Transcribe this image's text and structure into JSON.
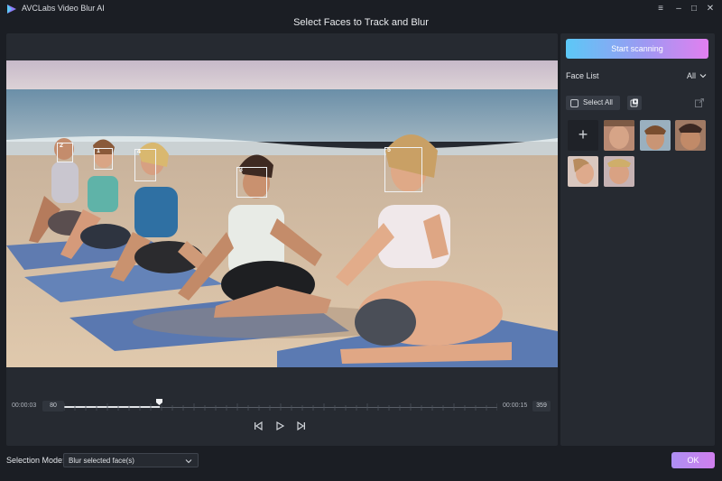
{
  "window": {
    "title": "AVCLabs Video Blur AI",
    "controls": [
      "≡",
      "–",
      "□",
      "✕"
    ]
  },
  "page_heading": "Select Faces to Track and Blur",
  "video": {
    "face_boxes": [
      "1",
      "2",
      "3",
      "4",
      "5"
    ],
    "current_time": "00:00:03",
    "current_frame": "80",
    "end_time": "00:00:15",
    "end_frame": "359",
    "progress_fraction": 0.22
  },
  "face_list": {
    "scan_button": "Start scanning",
    "label": "Face List",
    "filter": "All",
    "select_all": "Select All",
    "add_symbol": "+",
    "thumbnail_count": 5
  },
  "bottom": {
    "mode_label": "Selection Mode:",
    "mode_value": "Blur selected face(s)",
    "ok_button": "OK"
  },
  "colors": {
    "background": "#1b1e24",
    "panel": "#262a31",
    "scan_gradient": [
      "#5cc8f6",
      "#e27ff0"
    ],
    "ok_gradient": [
      "#ad8ff2",
      "#d07fee"
    ]
  },
  "icons": [
    "app-logo-icon",
    "menu-icon",
    "minimize-icon",
    "maximize-icon",
    "close-icon",
    "prev-frame-icon",
    "play-icon",
    "next-frame-icon",
    "chevron-down-icon",
    "manage-faces-icon",
    "export-icon",
    "plus-icon"
  ]
}
